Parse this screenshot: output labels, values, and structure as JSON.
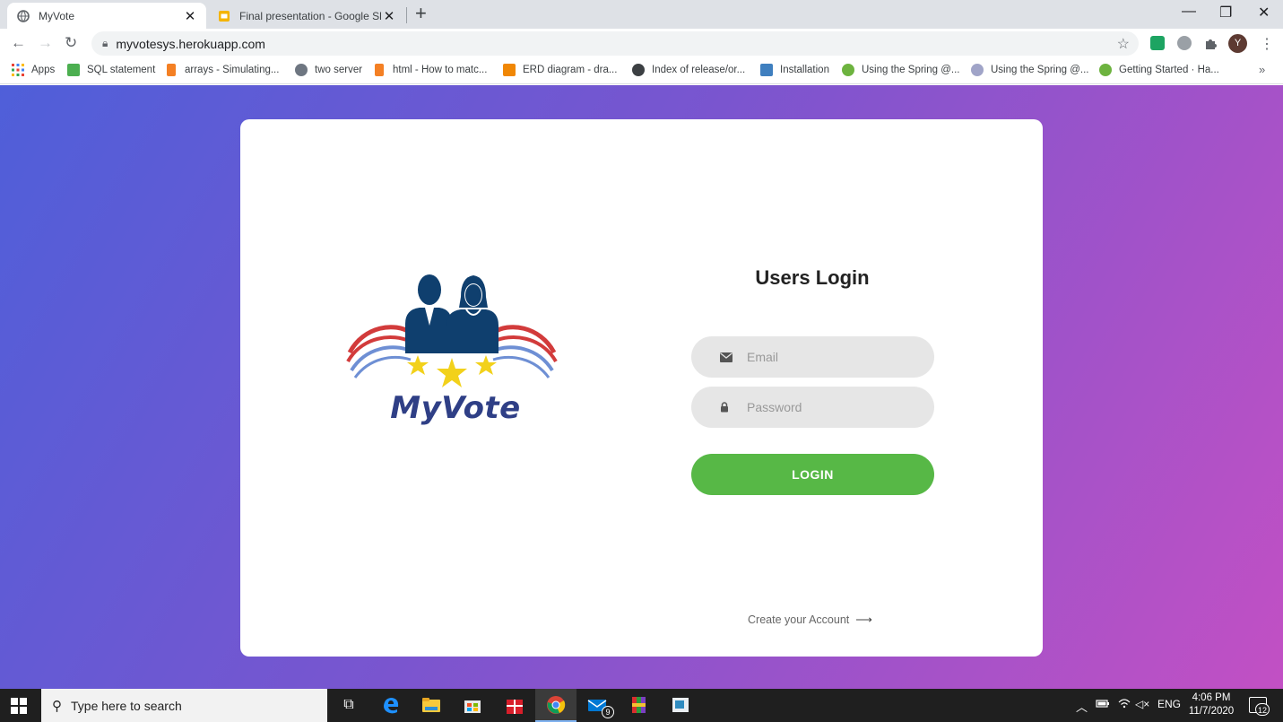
{
  "browser": {
    "tabs": [
      {
        "title": "MyVote",
        "active": true,
        "icon": "globe-icon"
      },
      {
        "title": "Final presentation - Google Slides",
        "active": false,
        "icon": "google-slides-icon"
      }
    ],
    "address": "myvotesys.herokuapp.com",
    "profile_initial": "Y",
    "bookmarks": [
      {
        "label": "Apps",
        "icon": "apps-grid-icon"
      },
      {
        "label": "SQL statement",
        "icon": "w3schools-icon"
      },
      {
        "label": "arrays - Simulating...",
        "icon": "stackoverflow-icon"
      },
      {
        "label": "two server",
        "icon": "github-icon"
      },
      {
        "label": "html - How to matc...",
        "icon": "stackoverflow-icon"
      },
      {
        "label": "ERD diagram - dra...",
        "icon": "drawio-icon"
      },
      {
        "label": "Index of release/or...",
        "icon": "globe-icon"
      },
      {
        "label": "Installation",
        "icon": "installation-icon"
      },
      {
        "label": "Using the Spring @...",
        "icon": "spring-icon"
      },
      {
        "label": "Using the Spring @...",
        "icon": "baeldung-icon"
      },
      {
        "label": "Getting Started · Ha...",
        "icon": "spring-icon"
      }
    ]
  },
  "login": {
    "logo_text": "MyVote",
    "title": "Users Login",
    "email_placeholder": "Email",
    "password_placeholder": "Password",
    "login_button": "LOGIN",
    "create_account": "Create your Account"
  },
  "taskbar": {
    "search_placeholder": "Type here to search",
    "mail_badge": "9",
    "language": "ENG",
    "time": "4:06 PM",
    "date": "11/7/2020",
    "notification_count": "12"
  },
  "colors": {
    "accent_green": "#57b846",
    "gradient_start": "#4f5fd9",
    "gradient_end": "#c250c4"
  }
}
